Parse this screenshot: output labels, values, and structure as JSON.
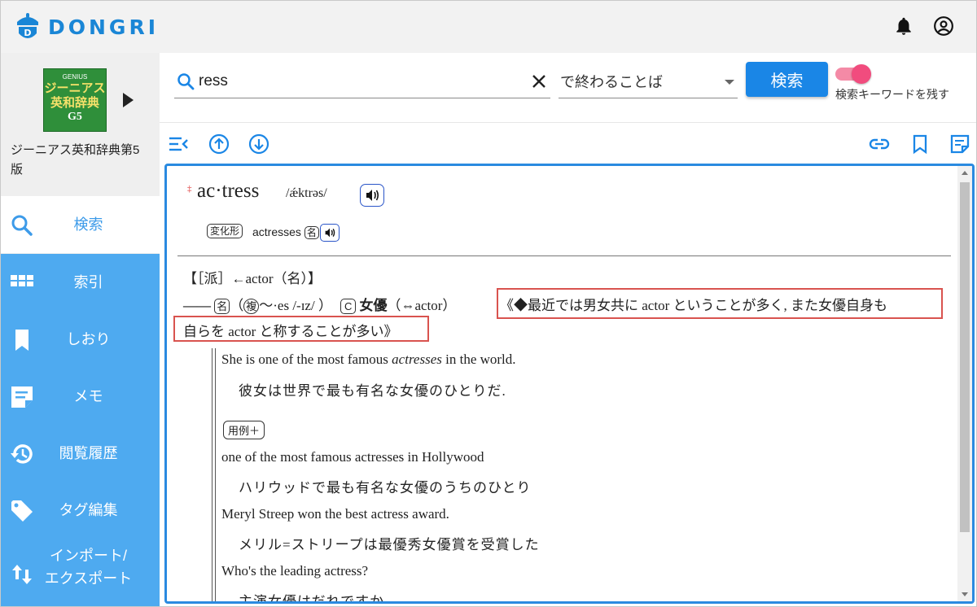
{
  "app": {
    "name": "DONGRI"
  },
  "book": {
    "cover_top": "GENIUS",
    "cover_line1": "ジーニアス",
    "cover_line2": "英和辞典",
    "cover_edition": "G5",
    "title": "ジーニアス英和辞典第5版"
  },
  "sidebar": {
    "items": [
      {
        "label": "検索",
        "icon": "search-icon"
      },
      {
        "label": "索引",
        "icon": "grid-icon"
      },
      {
        "label": "しおり",
        "icon": "bookmark-icon"
      },
      {
        "label": "メモ",
        "icon": "note-icon"
      },
      {
        "label": "閲覧履歴",
        "icon": "history-icon"
      },
      {
        "label": "タグ編集",
        "icon": "tag-icon"
      },
      {
        "label_line1": "インポート/",
        "label_line2": "エクスポート",
        "icon": "import-export-icon"
      }
    ]
  },
  "search": {
    "value": "ress",
    "mode": "で終わることば",
    "button": "検索",
    "keep_keyword_label": "検索キーワードを残す",
    "keep_keyword_on": true
  },
  "entry": {
    "headword": "ac·tress",
    "headword_mark": "‡",
    "pronunciation": "/ǽktrəs/",
    "inflection_tag": "変化形",
    "inflection": "actresses",
    "inflection_pos": "名",
    "derivation": "【［派］←actor（名）】",
    "sense_dash": "——",
    "sense_pos": "名",
    "sense_plural_mark": "複",
    "sense_plural": "〜·es /-ɪz/ ）",
    "sense_count": "C",
    "sense_word": "女優",
    "sense_contrast": "（⇔actor）",
    "note_line1": "《◆最近では男女共に actor ということが多く, また女優自身も",
    "note_line2": "自らを actor と称することが多い》",
    "examples": [
      {
        "en_pre": "She is one of the most famous ",
        "en_em": "actresses",
        "en_post": " in the world.",
        "ja": "彼女は世界で最も有名な女優のひとりだ."
      }
    ],
    "more_examples_label": "用例＋",
    "more_examples": [
      {
        "en": "one of the most famous actresses in Hollywood",
        "ja": "ハリウッドで最も有名な女優のうちのひとり"
      },
      {
        "en": "Meryl Streep won the best actress award.",
        "ja": "メリル=ストリープは最優秀女優賞を受賞した"
      },
      {
        "en": "Who's the leading actress?",
        "ja": "主演女優はだれですか"
      }
    ]
  },
  "colors": {
    "brand": "#1a86d6",
    "sidebar_active_bg": "#4eaaf0",
    "highlight_border": "#d9534f",
    "toggle_on": "#f14c7e"
  }
}
